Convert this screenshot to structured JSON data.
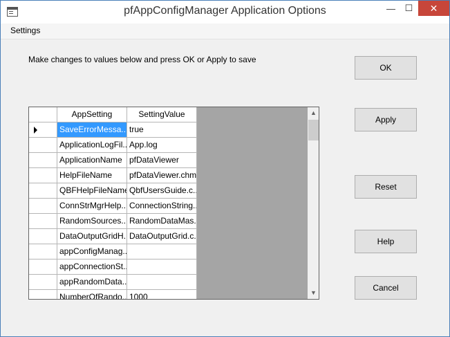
{
  "window": {
    "title": "pfAppConfigManager Application Options",
    "controls": {
      "minimize": "—",
      "maximize": "☐",
      "close": "✕"
    }
  },
  "menu": {
    "settings": "Settings"
  },
  "instructions": "Make changes to values below and press OK or Apply to save",
  "buttons": {
    "ok": "OK",
    "apply": "Apply",
    "reset": "Reset",
    "help": "Help",
    "cancel": "Cancel"
  },
  "grid": {
    "headers": {
      "setting": "AppSetting",
      "value": "SettingValue"
    },
    "rows": [
      {
        "setting": "SaveErrorMessa...",
        "value": "true"
      },
      {
        "setting": "ApplicationLogFil...",
        "value": "App.log"
      },
      {
        "setting": "ApplicationName",
        "value": "pfDataViewer"
      },
      {
        "setting": "HelpFileName",
        "value": "pfDataViewer.chm"
      },
      {
        "setting": "QBFHelpFileName",
        "value": "QbfUsersGuide.c..."
      },
      {
        "setting": "ConnStrMgrHelp...",
        "value": "ConnectionString..."
      },
      {
        "setting": "RandomSources...",
        "value": "RandomDataMas..."
      },
      {
        "setting": "DataOutputGridH...",
        "value": "DataOutputGrid.c..."
      },
      {
        "setting": "appConfigManag...",
        "value": ""
      },
      {
        "setting": "appConnectionSt...",
        "value": ""
      },
      {
        "setting": "appRandomData...",
        "value": ""
      },
      {
        "setting": "NumberOfRando...",
        "value": "1000"
      }
    ]
  },
  "scrollbar": {
    "up": "▲",
    "down": "▼"
  }
}
